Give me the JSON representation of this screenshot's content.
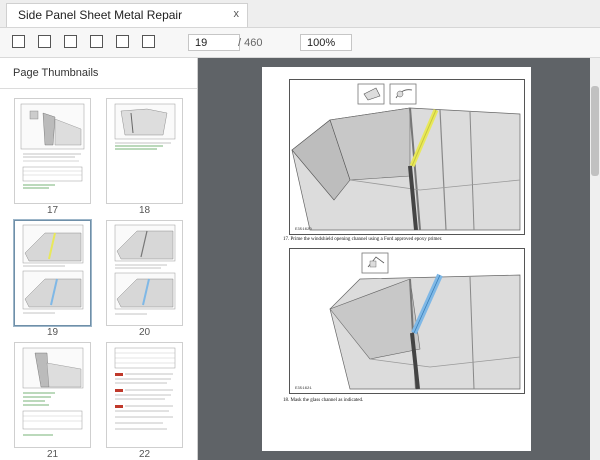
{
  "tab": {
    "title": "Side Panel Sheet Metal Repair",
    "close": "x"
  },
  "toolbar": {
    "buttons": [
      "first-page-icon",
      "previous-page-icon",
      "next-page-icon",
      "last-page-icon",
      "rotate-icon",
      "fit-page-icon"
    ],
    "page_number": "19",
    "page_total": "/ 460",
    "zoom": "100%"
  },
  "sidebar": {
    "title": "Page Thumbnails",
    "thumbnails": [
      {
        "label": "17"
      },
      {
        "label": "18"
      },
      {
        "label": "19",
        "selected": true
      },
      {
        "label": "20"
      },
      {
        "label": "21"
      },
      {
        "label": "22"
      }
    ]
  },
  "document": {
    "figure1_code": "E351620",
    "step17": "17. Prime the windshield opening channel using a Ford approved epoxy primer.",
    "figure2_code": "E351621",
    "step18": "18. Mask the glass channel as indicated."
  },
  "colors": {
    "viewer_bg": "#5f6367",
    "epoxy_highlight": "#e8e85a",
    "mask_highlight": "#7fb8e6",
    "selected_border": "#6f8fa8"
  }
}
